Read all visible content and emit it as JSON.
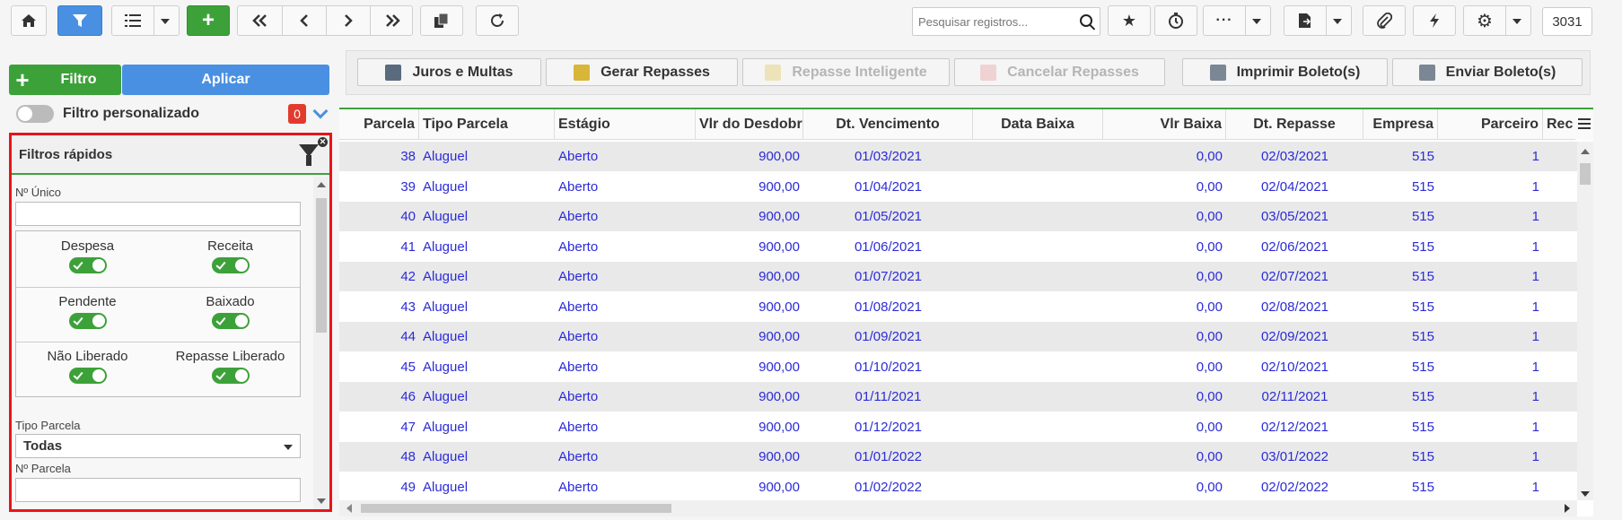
{
  "toolbar": {
    "search_placeholder": "Pesquisar registros...",
    "record_count": "3031",
    "icons": [
      "home-icon",
      "filter-icon",
      "list-icon",
      "plus-icon",
      "first-icon",
      "prev-icon",
      "next-icon",
      "last-icon",
      "duplicate-icon",
      "refresh-icon",
      "star-icon",
      "timer-icon",
      "more-icon",
      "export-icon",
      "attach-icon",
      "bolt-icon",
      "gear-icon"
    ]
  },
  "left_panel": {
    "filtro_label": "Filtro",
    "aplicar_label": "Aplicar",
    "custom_filter_label": "Filtro personalizado",
    "custom_filter_count": "0",
    "quick_filters": {
      "title": "Filtros rápidos",
      "numero_unico_label": "Nº Único",
      "numero_unico_value": "",
      "toggles": [
        {
          "label": "Despesa",
          "on": true
        },
        {
          "label": "Receita",
          "on": true
        },
        {
          "label": "Pendente",
          "on": true
        },
        {
          "label": "Baixado",
          "on": true
        },
        {
          "label": "Não Liberado",
          "on": true
        },
        {
          "label": "Repasse Liberado",
          "on": true
        }
      ],
      "tipo_parcela_label": "Tipo Parcela",
      "tipo_parcela_value": "Todas",
      "numero_parcela_label": "Nº Parcela",
      "numero_parcela_value": ""
    }
  },
  "actions": {
    "juros": "Juros e Multas",
    "gerar": "Gerar Repasses",
    "repasse_inteligente": "Repasse Inteligente",
    "cancelar": "Cancelar Repasses",
    "imprimir": "Imprimir Boleto(s)",
    "enviar": "Enviar Boleto(s)"
  },
  "grid": {
    "columns": [
      "Parcela",
      "Tipo Parcela",
      "Estágio",
      "Vlr do Desdobra",
      "Dt. Vencimento",
      "Data Baixa",
      "Vlr Baixa",
      "Dt. Repasse",
      "Empresa",
      "Parceiro",
      "Rec"
    ],
    "rows": [
      [
        "38",
        "Aluguel",
        "Aberto",
        "900,00",
        "01/03/2021",
        "",
        "0,00",
        "02/03/2021",
        "515",
        "1"
      ],
      [
        "39",
        "Aluguel",
        "Aberto",
        "900,00",
        "01/04/2021",
        "",
        "0,00",
        "02/04/2021",
        "515",
        "1"
      ],
      [
        "40",
        "Aluguel",
        "Aberto",
        "900,00",
        "01/05/2021",
        "",
        "0,00",
        "03/05/2021",
        "515",
        "1"
      ],
      [
        "41",
        "Aluguel",
        "Aberto",
        "900,00",
        "01/06/2021",
        "",
        "0,00",
        "02/06/2021",
        "515",
        "1"
      ],
      [
        "42",
        "Aluguel",
        "Aberto",
        "900,00",
        "01/07/2021",
        "",
        "0,00",
        "02/07/2021",
        "515",
        "1"
      ],
      [
        "43",
        "Aluguel",
        "Aberto",
        "900,00",
        "01/08/2021",
        "",
        "0,00",
        "02/08/2021",
        "515",
        "1"
      ],
      [
        "44",
        "Aluguel",
        "Aberto",
        "900,00",
        "01/09/2021",
        "",
        "0,00",
        "02/09/2021",
        "515",
        "1"
      ],
      [
        "45",
        "Aluguel",
        "Aberto",
        "900,00",
        "01/10/2021",
        "",
        "0,00",
        "02/10/2021",
        "515",
        "1"
      ],
      [
        "46",
        "Aluguel",
        "Aberto",
        "900,00",
        "01/11/2021",
        "",
        "0,00",
        "02/11/2021",
        "515",
        "1"
      ],
      [
        "47",
        "Aluguel",
        "Aberto",
        "900,00",
        "01/12/2021",
        "",
        "0,00",
        "02/12/2021",
        "515",
        "1"
      ],
      [
        "48",
        "Aluguel",
        "Aberto",
        "900,00",
        "01/01/2022",
        "",
        "0,00",
        "03/01/2022",
        "515",
        "1"
      ],
      [
        "49",
        "Aluguel",
        "Aberto",
        "900,00",
        "01/02/2022",
        "",
        "0,00",
        "02/02/2022",
        "515",
        "1"
      ]
    ]
  },
  "colors": {
    "green": "#3da13a",
    "blue": "#4a90e2",
    "red_border": "#e8141a",
    "cell_text": "#2b2bd8"
  }
}
